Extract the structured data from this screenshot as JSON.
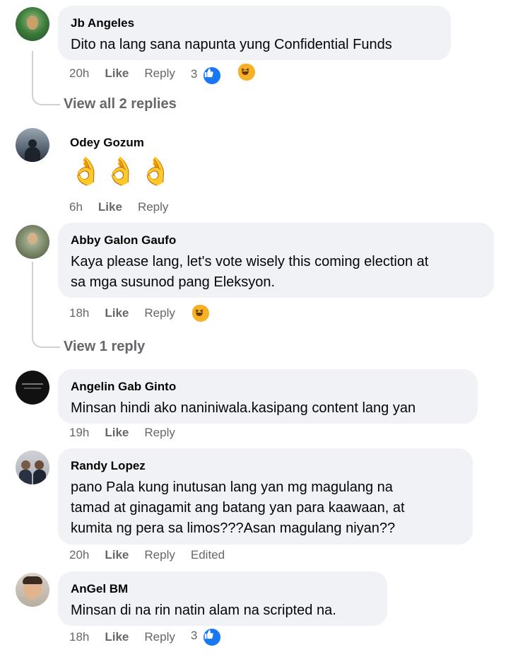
{
  "comments": [
    {
      "name": "Jb Angeles",
      "text": [
        "Dito na lang sana napunta yung Confidential Funds"
      ],
      "time": "20h",
      "like": "Like",
      "reply": "Reply",
      "reaction_count": "3",
      "reactions": [
        "like-icon",
        "haha-icon"
      ]
    },
    {
      "name": "Odey Gozum",
      "emoji": [
        "👌",
        "👌",
        "👌"
      ],
      "time": "6h",
      "like": "Like",
      "reply": "Reply"
    },
    {
      "name": "Abby Galon Gaufo",
      "text": [
        "Kaya please lang, let's vote wisely this coming election at",
        "sa mga susunod pang Eleksyon."
      ],
      "time": "18h",
      "like": "Like",
      "reply": "Reply",
      "reactions": [
        "haha-icon"
      ]
    },
    {
      "name": "Angelin Gab Ginto",
      "text": [
        "Minsan hindi ako naniniwala.kasipang content lang yan"
      ],
      "time": "19h",
      "like": "Like",
      "reply": "Reply"
    },
    {
      "name": "Randy Lopez",
      "text": [
        "pano Pala kung inutusan lang yan mg magulang na",
        "tamad at ginagamit ang batang yan para kaawaan, at",
        "kumita ng pera sa limos???Asan magulang niyan??"
      ],
      "time": "20h",
      "like": "Like",
      "reply": "Reply",
      "edited": "Edited"
    },
    {
      "name": "AnGel BM",
      "text": [
        "Minsan di na rin natin alam na scripted na."
      ],
      "time": "18h",
      "like": "Like",
      "reply": "Reply",
      "reaction_count": "3",
      "reactions": [
        "like-icon"
      ]
    }
  ],
  "view_replies": [
    "View all 2 replies",
    "View 1 reply"
  ],
  "colors": {
    "bubble": "#f0f2f5",
    "meta": "#65676b",
    "like_blue": "#1877f2",
    "haha_yellow": "#f7b125",
    "thread": "#ced0d4"
  }
}
